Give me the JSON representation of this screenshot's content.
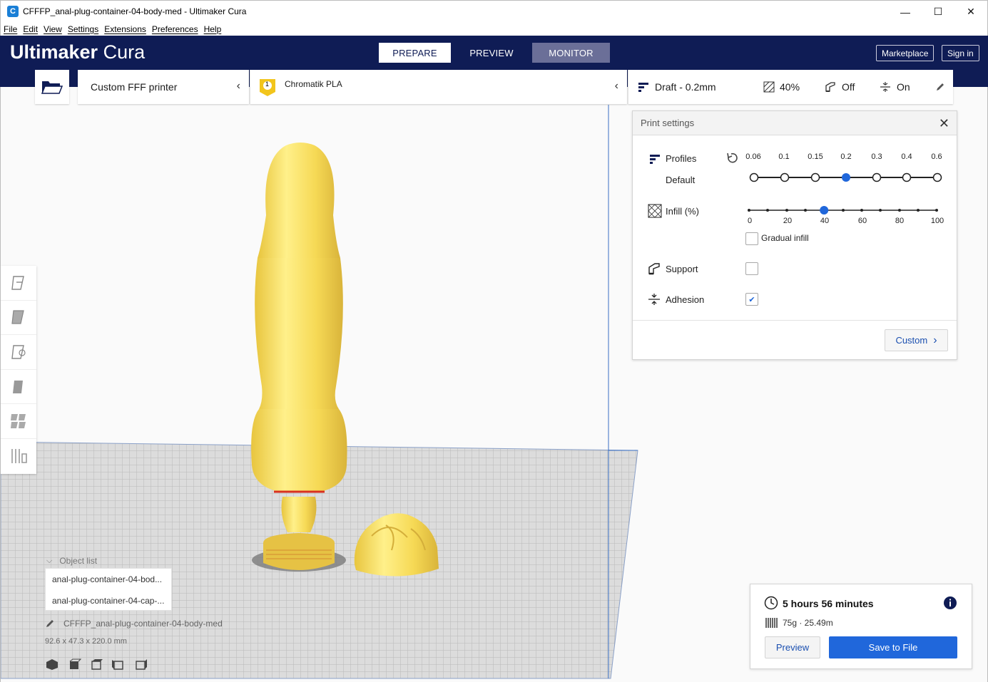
{
  "window": {
    "title": "CFFFP_anal-plug-container-04-body-med - Ultimaker Cura",
    "minimize": "—",
    "maximize": "☐",
    "close": "✕"
  },
  "menu": [
    "File",
    "Edit",
    "View",
    "Settings",
    "Extensions",
    "Preferences",
    "Help"
  ],
  "header": {
    "logo_bold": "Ultimaker",
    "logo_light": "Cura",
    "tabs": [
      "PREPARE",
      "PREVIEW",
      "MONITOR"
    ],
    "active_tab": "PREPARE",
    "marketplace": "Marketplace",
    "signin": "Sign in"
  },
  "toolbar": {
    "printer": "Custom FFF printer",
    "material_badge": "1",
    "material": "Chromatik PLA",
    "profile": "Draft - 0.2mm",
    "infill": "40%",
    "support": "Off",
    "adhesion": "On"
  },
  "print_settings": {
    "title": "Print settings",
    "profiles_label": "Profiles",
    "profiles_sub": "Default",
    "layer_heights": [
      "0.06",
      "0.1",
      "0.15",
      "0.2",
      "0.3",
      "0.4",
      "0.6"
    ],
    "selected_layer_height": "0.2",
    "infill_label": "Infill (%)",
    "infill_ticks": [
      "0",
      "20",
      "40",
      "60",
      "80",
      "100"
    ],
    "infill_value": 40,
    "gradual_infill_label": "Gradual infill",
    "gradual_infill": false,
    "support_label": "Support",
    "support": false,
    "adhesion_label": "Adhesion",
    "adhesion": true,
    "custom_button": "Custom"
  },
  "object_list": {
    "header": "Object list",
    "items": [
      "anal-plug-container-04-bod...",
      "anal-plug-container-04-cap-..."
    ],
    "selected_name": "CFFFP_anal-plug-container-04-body-med",
    "dimensions": "92.6 x 47.3 x 220.0 mm"
  },
  "action_panel": {
    "time": "5 hours 56 minutes",
    "material": "75g · 25.49m",
    "preview_button": "Preview",
    "save_button": "Save to File"
  },
  "colors": {
    "header_bg": "#0f1c55",
    "accent": "#2067db",
    "model": "#f9e26a"
  }
}
